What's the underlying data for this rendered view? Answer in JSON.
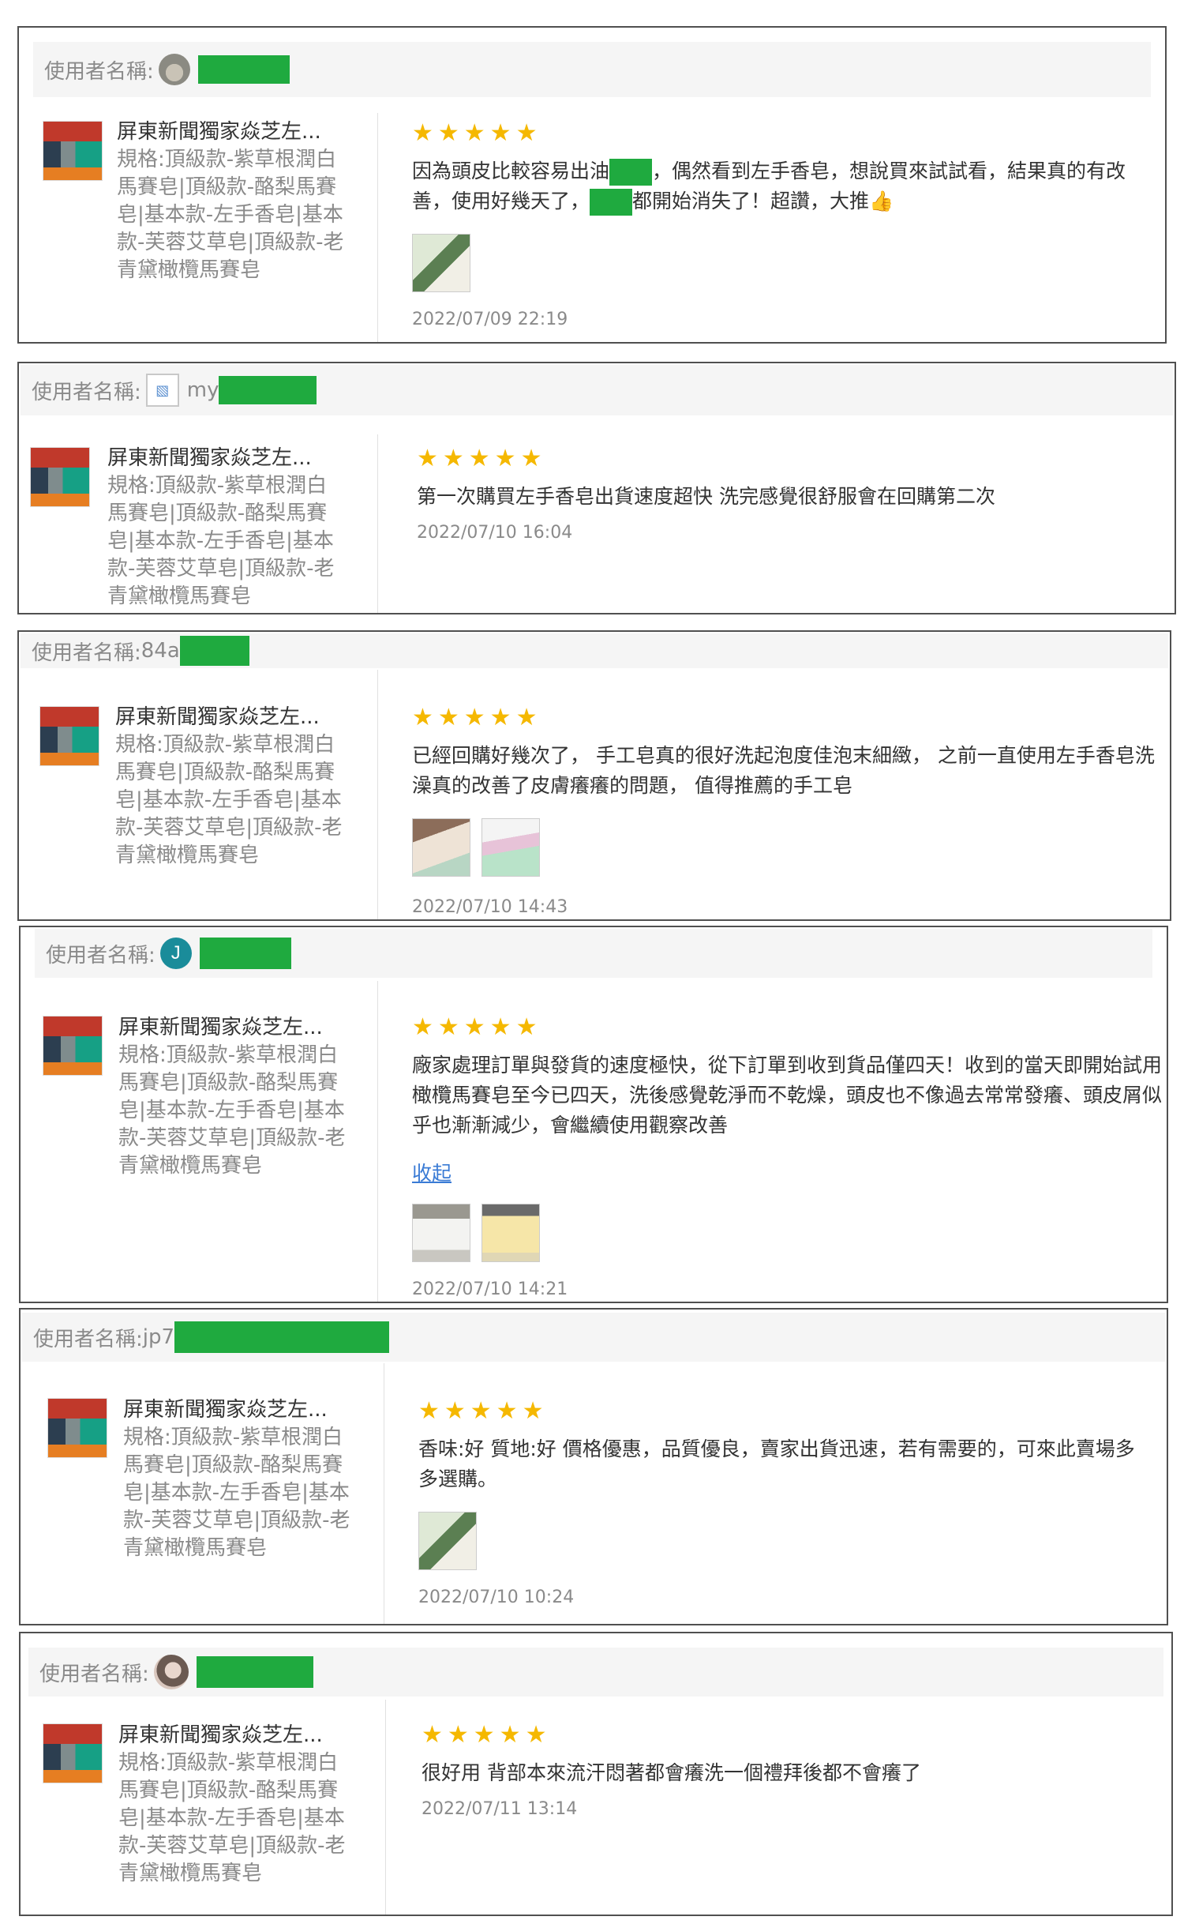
{
  "reviews": [
    {
      "user_label": "使用者名稱:",
      "user_prefix": "",
      "avatar_type": "photo1",
      "product_name": "屏東新聞獨家焱芝左...",
      "product_spec": "規格:頂級款-紫草根潤白馬賽皂|頂級款-酪梨馬賽皂|基本款-左手香皂|基本款-芙蓉艾草皂|頂級款-老青黛橄欖馬賽皂",
      "stars": "★★★★★",
      "text": "因為頭皮比較容易出油▇▇▇，偶然看到左手香皂，想說買來試試看，結果真的有改善，使用好幾天了，▇▇▇都開始消失了！超讚，大推👍",
      "photos": [
        "p1"
      ],
      "collapse": "",
      "date": "2022/07/09 22:19"
    },
    {
      "user_label": "使用者名稱:",
      "user_prefix": "my",
      "avatar_type": "broken",
      "product_name": "屏東新聞獨家焱芝左...",
      "product_spec": "規格:頂級款-紫草根潤白馬賽皂|頂級款-酪梨馬賽皂|基本款-左手香皂|基本款-芙蓉艾草皂|頂級款-老青黛橄欖馬賽皂",
      "stars": "★★★★★",
      "text": "第一次購買左手香皂出貨速度超快 洗完感覺很舒服會在回購第二次",
      "photos": [],
      "collapse": "",
      "date": "2022/07/10 16:04"
    },
    {
      "user_label": "使用者名稱:",
      "user_prefix": "84a",
      "avatar_type": "none",
      "product_name": "屏東新聞獨家焱芝左...",
      "product_spec": "規格:頂級款-紫草根潤白馬賽皂|頂級款-酪梨馬賽皂|基本款-左手香皂|基本款-芙蓉艾草皂|頂級款-老青黛橄欖馬賽皂",
      "stars": "★★★★★",
      "text": "已經回購好幾次了， 手工皂真的很好洗起泡度佳泡末細緻， 之前一直使用左手香皂洗澡真的改善了皮膚癢癢的問題， 值得推薦的手工皂",
      "photos": [
        "p2",
        "p3"
      ],
      "collapse": "",
      "date": "2022/07/10 14:43"
    },
    {
      "user_label": "使用者名稱:",
      "user_prefix": "",
      "avatar_type": "letter",
      "avatar_letter": "J",
      "product_name": "屏東新聞獨家焱芝左...",
      "product_spec": "規格:頂級款-紫草根潤白馬賽皂|頂級款-酪梨馬賽皂|基本款-左手香皂|基本款-芙蓉艾草皂|頂級款-老青黛橄欖馬賽皂",
      "stars": "★★★★★",
      "text": "廠家處理訂單與發貨的速度極快，從下訂單到收到貨品僅四天！收到的當天即開始試用橄欖馬賽皂至今已四天，洗後感覺乾淨而不乾燥，頭皮也不像過去常常發癢、頭皮屑似乎也漸漸減少，會繼續使用觀察改善",
      "photos": [
        "p4",
        "p5"
      ],
      "collapse": "收起",
      "date": "2022/07/10 14:21"
    },
    {
      "user_label": "使用者名稱:",
      "user_prefix": "jp7",
      "avatar_type": "none",
      "product_name": "屏東新聞獨家焱芝左...",
      "product_spec": "規格:頂級款-紫草根潤白馬賽皂|頂級款-酪梨馬賽皂|基本款-左手香皂|基本款-芙蓉艾草皂|頂級款-老青黛橄欖馬賽皂",
      "stars": "★★★★★",
      "text": "香味:好 質地:好 價格優惠，品質優良，賣家出貨迅速，若有需要的，可來此賣場多多選購。",
      "photos": [
        "p1"
      ],
      "collapse": "",
      "date": "2022/07/10 10:24"
    },
    {
      "user_label": "使用者名稱:",
      "user_prefix": "",
      "avatar_type": "photo2",
      "product_name": "屏東新聞獨家焱芝左...",
      "product_spec": "規格:頂級款-紫草根潤白馬賽皂|頂級款-酪梨馬賽皂|基本款-左手香皂|基本款-芙蓉艾草皂|頂級款-老青黛橄欖馬賽皂",
      "stars": "★★★★★",
      "text": "很好用 背部本來流汗悶著都會癢洗一個禮拜後都不會癢了",
      "photos": [],
      "collapse": "",
      "date": "2022/07/11 13:14"
    }
  ]
}
